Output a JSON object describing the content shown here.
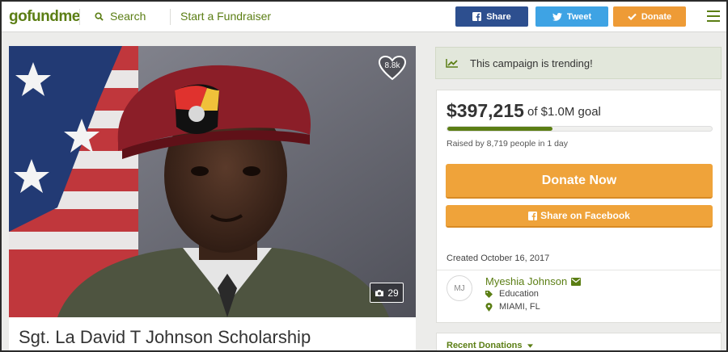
{
  "header": {
    "logo_parts": [
      "go",
      "fund",
      "me"
    ],
    "search_label": "Search",
    "start_label": "Start a Fundraiser",
    "share_label": "Share",
    "tweet_label": "Tweet",
    "donate_label": "Donate"
  },
  "campaign": {
    "title": "Sgt. La David T Johnson Scholarship",
    "likes": "8.8k",
    "photo_count": "29",
    "trending": "This campaign is trending!",
    "amount": "$397,215",
    "goal": "of $1.0M goal",
    "progress_fraction": 0.397,
    "raised_text": "Raised by 8,719 people in 1 day",
    "donate_now_label": "Donate Now",
    "share_facebook_label": "Share on Facebook",
    "created": "Created October 16, 2017"
  },
  "organizer": {
    "initials": "MJ",
    "name": "Myeshia Johnson",
    "category": "Education",
    "location": "MIAMI, FL"
  },
  "recent": {
    "label": "Recent Donations"
  },
  "colors": {
    "brand_green": "#5b7e14",
    "orange": "#efa33a",
    "facebook": "#2d4f8f",
    "twitter": "#3ea3e4"
  }
}
